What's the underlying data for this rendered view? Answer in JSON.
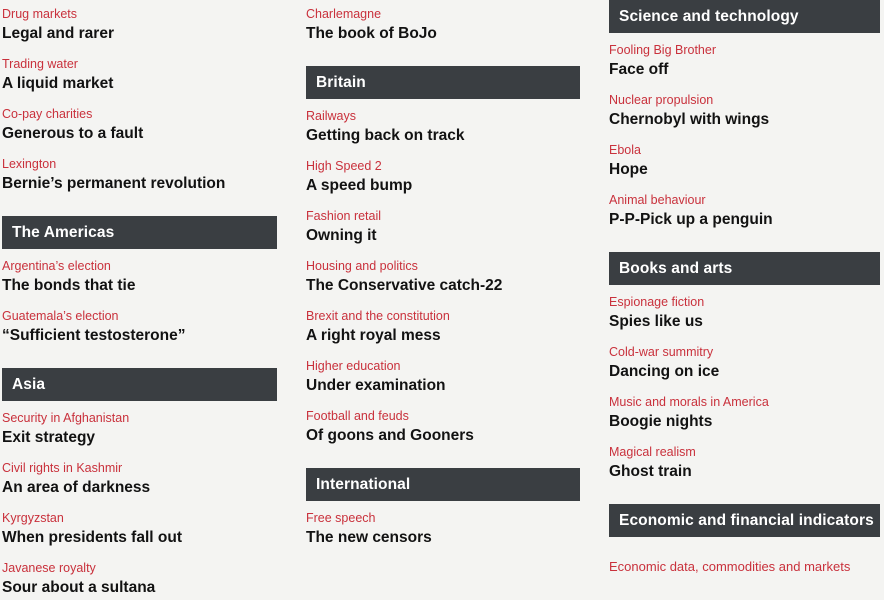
{
  "theme": {
    "background": "#f4f4f2",
    "header_bar": "#3a3e42",
    "header_text": "#ffffff",
    "kicker": "#c9313c",
    "headline": "#121212"
  },
  "columns": [
    {
      "id": "column-1",
      "lead_articles": [
        {
          "kicker": "Drug markets",
          "headline": "Legal and rarer"
        },
        {
          "kicker": "Trading water",
          "headline": "A liquid market"
        },
        {
          "kicker": "Co-pay charities",
          "headline": "Generous to a fault"
        },
        {
          "kicker": "Lexington",
          "headline": "Bernie’s permanent revolution"
        }
      ],
      "sections": [
        {
          "title": "The Americas",
          "articles": [
            {
              "kicker": "Argentina’s election",
              "headline": "The bonds that tie"
            },
            {
              "kicker": "Guatemala’s election",
              "headline": "“Sufficient testosterone”"
            }
          ]
        },
        {
          "title": "Asia",
          "articles": [
            {
              "kicker": "Security in Afghanistan",
              "headline": "Exit strategy"
            },
            {
              "kicker": "Civil rights in Kashmir",
              "headline": "An area of darkness"
            },
            {
              "kicker": "Kyrgyzstan",
              "headline": "When presidents fall out"
            },
            {
              "kicker": "Javanese royalty",
              "headline": "Sour about a sultana"
            }
          ]
        }
      ]
    },
    {
      "id": "column-2",
      "lead_articles": [
        {
          "kicker": "Charlemagne",
          "headline": "The book of BoJo"
        }
      ],
      "sections": [
        {
          "title": "Britain",
          "articles": [
            {
              "kicker": "Railways",
              "headline": "Getting back on track"
            },
            {
              "kicker": "High Speed 2",
              "headline": "A speed bump"
            },
            {
              "kicker": "Fashion retail",
              "headline": "Owning it"
            },
            {
              "kicker": "Housing and politics",
              "headline": "The Conservative catch-22"
            },
            {
              "kicker": "Brexit and the constitution",
              "headline": "A right royal mess"
            },
            {
              "kicker": "Higher education",
              "headline": "Under examination"
            },
            {
              "kicker": "Football and feuds",
              "headline": "Of goons and Gooners"
            }
          ]
        },
        {
          "title": "International",
          "articles": [
            {
              "kicker": "Free speech",
              "headline": "The new censors"
            }
          ]
        }
      ]
    },
    {
      "id": "column-3",
      "lead_articles": [],
      "sections": [
        {
          "title": "Science and technology",
          "articles": [
            {
              "kicker": "Fooling Big Brother",
              "headline": "Face off"
            },
            {
              "kicker": "Nuclear propulsion",
              "headline": "Chernobyl with wings"
            },
            {
              "kicker": "Ebola",
              "headline": "Hope"
            },
            {
              "kicker": "Animal behaviour",
              "headline": "P-P-Pick up a penguin"
            }
          ]
        },
        {
          "title": "Books and arts",
          "articles": [
            {
              "kicker": "Espionage fiction",
              "headline": "Spies like us"
            },
            {
              "kicker": "Cold-war summitry",
              "headline": "Dancing on ice"
            },
            {
              "kicker": "Music and morals in America",
              "headline": "Boogie nights"
            },
            {
              "kicker": "Magical realism",
              "headline": "Ghost train"
            }
          ]
        },
        {
          "title": "Economic and financial indicators",
          "articles": [],
          "indicator_line": "Economic data, commodities and markets"
        }
      ]
    }
  ]
}
